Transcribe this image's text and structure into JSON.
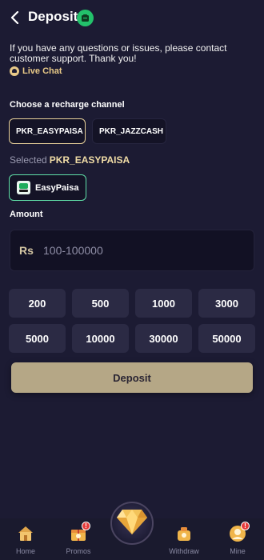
{
  "header": {
    "title": "Deposit",
    "back_icon": "chevron-left-icon",
    "wallet_icon": "wallet-icon"
  },
  "notice": {
    "text": "If you have any questions or issues, please contact customer support. Thank you!",
    "live_chat_label": "Live Chat"
  },
  "channel_section": {
    "label": "Choose a recharge channel",
    "channels": [
      {
        "label": "PKR_EASYPAISA",
        "selected": true
      },
      {
        "label": "PKR_JAZZCASH",
        "selected": false
      }
    ],
    "selected_prefix": "Selected",
    "selected_value": "PKR_EASYPAISA"
  },
  "payment_method": {
    "label": "EasyPaisa",
    "icon": "easypaisa-logo"
  },
  "amount": {
    "label": "Amount",
    "currency": "Rs",
    "placeholder": "100-100000",
    "value": ""
  },
  "presets": [
    "200",
    "500",
    "1000",
    "3000",
    "5000",
    "10000",
    "30000",
    "50000"
  ],
  "deposit_button": {
    "label": "Deposit"
  },
  "tabbar": {
    "items": [
      {
        "label": "Home",
        "icon": "home-icon"
      },
      {
        "label": "Promos",
        "icon": "gift-icon",
        "badge": "!"
      },
      {
        "label": "",
        "icon": "diamond-icon"
      },
      {
        "label": "Withdraw",
        "icon": "withdraw-icon"
      },
      {
        "label": "Mine",
        "icon": "user-icon",
        "badge": "!"
      }
    ]
  },
  "colors": {
    "background": "#1c1b33",
    "accent_gold": "#e8d19a",
    "button_gold": "#b5a786",
    "selected_green": "#5fe0a8",
    "wallet_green": "#23c16b"
  }
}
